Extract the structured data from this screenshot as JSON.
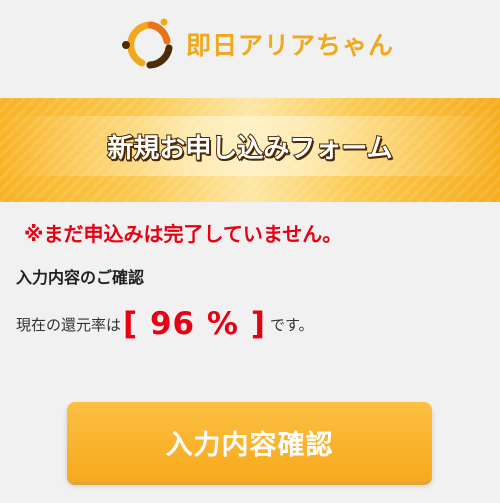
{
  "header": {
    "logo_text": "即日アリアちゃん",
    "logo_icon": "orbit-logo-icon"
  },
  "banner": {
    "title": "新規お申し込みフォーム"
  },
  "main": {
    "warning": "※まだ申込みは完了していません。",
    "section_title": "入力内容のご確認",
    "rate_prefix": "現在の還元率は",
    "rate_value": "[ 96 % ]",
    "rate_suffix": "です。"
  },
  "confirm_button": {
    "label": "入力内容確認"
  },
  "colors": {
    "accent": "#f0a81c",
    "alert": "#e60012",
    "button": "#f7a91c"
  }
}
